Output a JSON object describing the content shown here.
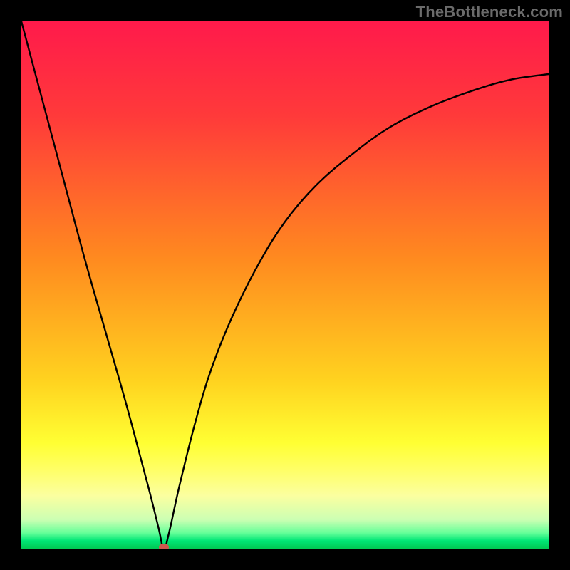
{
  "watermark": "TheBottleneck.com",
  "colors": {
    "frame": "#000000",
    "curve": "#000000",
    "marker": "#cf574e",
    "gradient_stops": [
      {
        "offset": 0.0,
        "color": "#ff1a4b"
      },
      {
        "offset": 0.18,
        "color": "#ff3a3a"
      },
      {
        "offset": 0.45,
        "color": "#ff8a1f"
      },
      {
        "offset": 0.68,
        "color": "#ffd21f"
      },
      {
        "offset": 0.8,
        "color": "#ffff33"
      },
      {
        "offset": 0.85,
        "color": "#ffff66"
      },
      {
        "offset": 0.9,
        "color": "#fbffa0"
      },
      {
        "offset": 0.945,
        "color": "#ccffb3"
      },
      {
        "offset": 0.97,
        "color": "#66ff99"
      },
      {
        "offset": 0.985,
        "color": "#00e676"
      },
      {
        "offset": 1.0,
        "color": "#00c853"
      }
    ]
  },
  "chart_data": {
    "type": "line",
    "title": "",
    "xlabel": "",
    "ylabel": "",
    "xlim": [
      0,
      100
    ],
    "ylim": [
      0,
      100
    ],
    "grid": false,
    "legend": false,
    "series": [
      {
        "name": "bottleneck-curve",
        "x": [
          0,
          4,
          8,
          12,
          16,
          20,
          24,
          26,
          27,
          28,
          30,
          33,
          36,
          40,
          45,
          50,
          56,
          63,
          70,
          78,
          86,
          93,
          100
        ],
        "y": [
          100,
          85,
          70,
          55,
          41,
          27,
          12,
          4,
          0,
          3,
          12,
          24,
          34,
          44,
          54,
          62,
          69,
          75,
          80,
          84,
          87,
          89,
          90
        ]
      }
    ],
    "annotations": [
      {
        "name": "min-marker",
        "x": 27,
        "y": 0
      }
    ]
  }
}
